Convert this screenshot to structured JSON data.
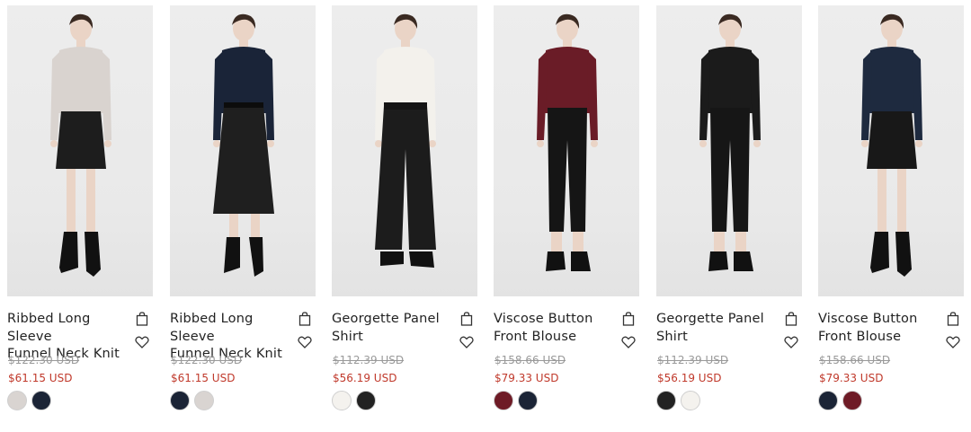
{
  "products": [
    {
      "title_line1": "Ribbed Long Sleeve",
      "title_line2": "Funnel Neck Knit",
      "original_price": "$122.30 USD",
      "sale_price": "$61.15 USD",
      "swatches": [
        "#d9d4d1",
        "#1b2436"
      ],
      "top_color": "#d9d3cf",
      "bottom_color": "#1d1d1d",
      "bottom_style": "short-skirt"
    },
    {
      "title_line1": "Ribbed Long Sleeve",
      "title_line2": "Funnel Neck Knit",
      "original_price": "$122.30 USD",
      "sale_price": "$61.15 USD",
      "swatches": [
        "#1b2436",
        "#d9d4d1"
      ],
      "top_color": "#1a2438",
      "bottom_color": "#1f1f1f",
      "bottom_style": "midi-skirt"
    },
    {
      "title_line1": "Georgette Panel",
      "title_line2": "Shirt",
      "original_price": "$112.39 USD",
      "sale_price": "$56.19 USD",
      "swatches": [
        "#f4f2ee",
        "#222222"
      ],
      "top_color": "#f3f1ec",
      "bottom_color": "#1c1c1c",
      "bottom_style": "wide-pants"
    },
    {
      "title_line1": "Viscose Button",
      "title_line2": "Front Blouse",
      "original_price": "$158.66 USD",
      "sale_price": "$79.33 USD",
      "swatches": [
        "#6e1b26",
        "#1b2436"
      ],
      "top_color": "#6a1c27",
      "bottom_color": "#151515",
      "bottom_style": "slim-pants"
    },
    {
      "title_line1": "Georgette Panel",
      "title_line2": "Shirt",
      "original_price": "$112.39 USD",
      "sale_price": "$56.19 USD",
      "swatches": [
        "#222222",
        "#f4f2ee"
      ],
      "top_color": "#1b1b1b",
      "bottom_color": "#161616",
      "bottom_style": "slim-pants"
    },
    {
      "title_line1": "Viscose Button",
      "title_line2": "Front Blouse",
      "original_price": "$158.66 USD",
      "sale_price": "$79.33 USD",
      "swatches": [
        "#1b2436",
        "#6e1b26"
      ],
      "top_color": "#1e2a3f",
      "bottom_color": "#181818",
      "bottom_style": "short-skirt"
    }
  ],
  "icons": {
    "bag": "shopping-bag-icon",
    "wishlist": "heart-icon"
  }
}
